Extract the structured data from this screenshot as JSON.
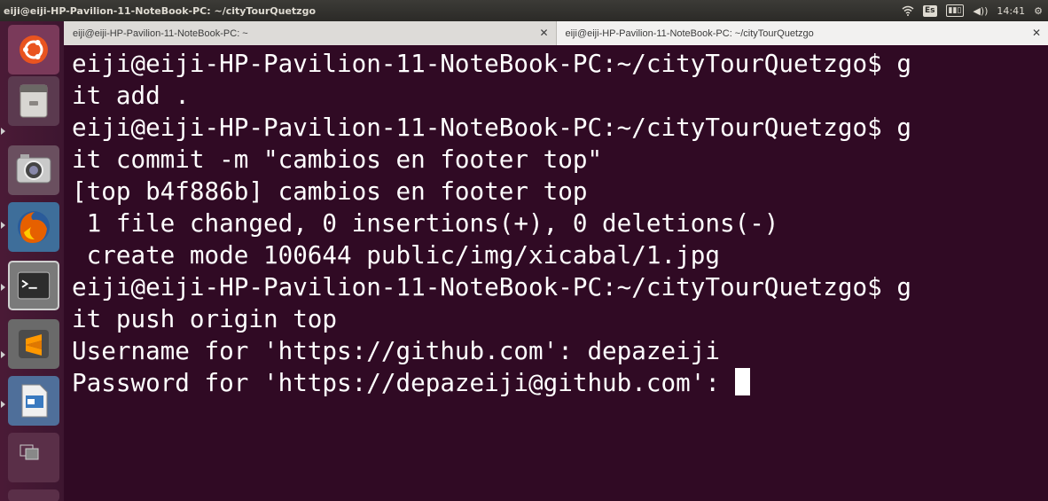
{
  "panel": {
    "title": "eiji@eiji-HP-Pavilion-11-NoteBook-PC: ~/cityTourQuetzgo",
    "keyboard_layout": "Es",
    "time": "14:41",
    "icons": [
      "wifi-icon",
      "battery-icon",
      "volume-icon",
      "settings-gear-icon"
    ]
  },
  "launcher": {
    "items": [
      {
        "name": "ubuntu-dash-icon",
        "running": false
      },
      {
        "name": "files-icon",
        "running": true
      },
      {
        "name": "camera-shotwell-icon",
        "running": true
      },
      {
        "name": "firefox-icon",
        "running": true
      },
      {
        "name": "terminal-icon",
        "running": true
      },
      {
        "name": "sublime-text-icon",
        "running": true
      },
      {
        "name": "libreoffice-impress-icon",
        "running": true
      },
      {
        "name": "workspace-switcher-icon",
        "running": false
      }
    ]
  },
  "tabs": [
    {
      "label": "eiji@eiji-HP-Pavilion-11-NoteBook-PC: ~",
      "active": false
    },
    {
      "label": "eiji@eiji-HP-Pavilion-11-NoteBook-PC: ~/cityTourQuetzgo",
      "active": true
    }
  ],
  "terminal": {
    "lines": [
      "eiji@eiji-HP-Pavilion-11-NoteBook-PC:~/cityTourQuetzgo$ g",
      "it add .",
      "eiji@eiji-HP-Pavilion-11-NoteBook-PC:~/cityTourQuetzgo$ g",
      "it commit -m \"cambios en footer top\"",
      "[top b4f886b] cambios en footer top",
      " 1 file changed, 0 insertions(+), 0 deletions(-)",
      " create mode 100644 public/img/xicabal/1.jpg",
      "eiji@eiji-HP-Pavilion-11-NoteBook-PC:~/cityTourQuetzgo$ g",
      "it push origin top",
      "Username for 'https://github.com': depazeiji",
      "Password for 'https://depazeiji@github.com': "
    ]
  },
  "colors": {
    "terminal_bg": "#300a24",
    "launcher_bg": "#4a1a36",
    "panel_bg": "#3c3b37"
  }
}
